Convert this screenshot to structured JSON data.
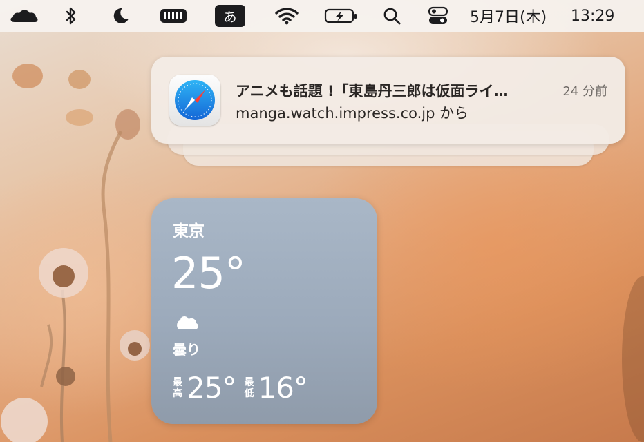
{
  "menubar": {
    "icons": [
      "cloudflare-icon",
      "bluetooth-icon",
      "focus-moon-icon",
      "battery-cells-icon",
      "input-method-icon",
      "wifi-icon",
      "battery-charging-icon",
      "spotlight-search-icon",
      "control-center-icon"
    ],
    "input_method_label": "あ",
    "date": "5月7日(木)",
    "time": "13:29"
  },
  "notification": {
    "app_icon": "safari-icon",
    "title": "アニメも話題 !「東島丹三郎は仮面ライ…",
    "time_ago": "24 分前",
    "body": "manga.watch.impress.co.jp から"
  },
  "weather": {
    "city": "東京",
    "temperature": "25°",
    "condition_icon": "cloud-icon",
    "condition": "曇り",
    "high_label_1": "最",
    "high_label_2": "高",
    "high": "25°",
    "low_label_1": "最",
    "low_label_2": "低",
    "low": "16°"
  }
}
